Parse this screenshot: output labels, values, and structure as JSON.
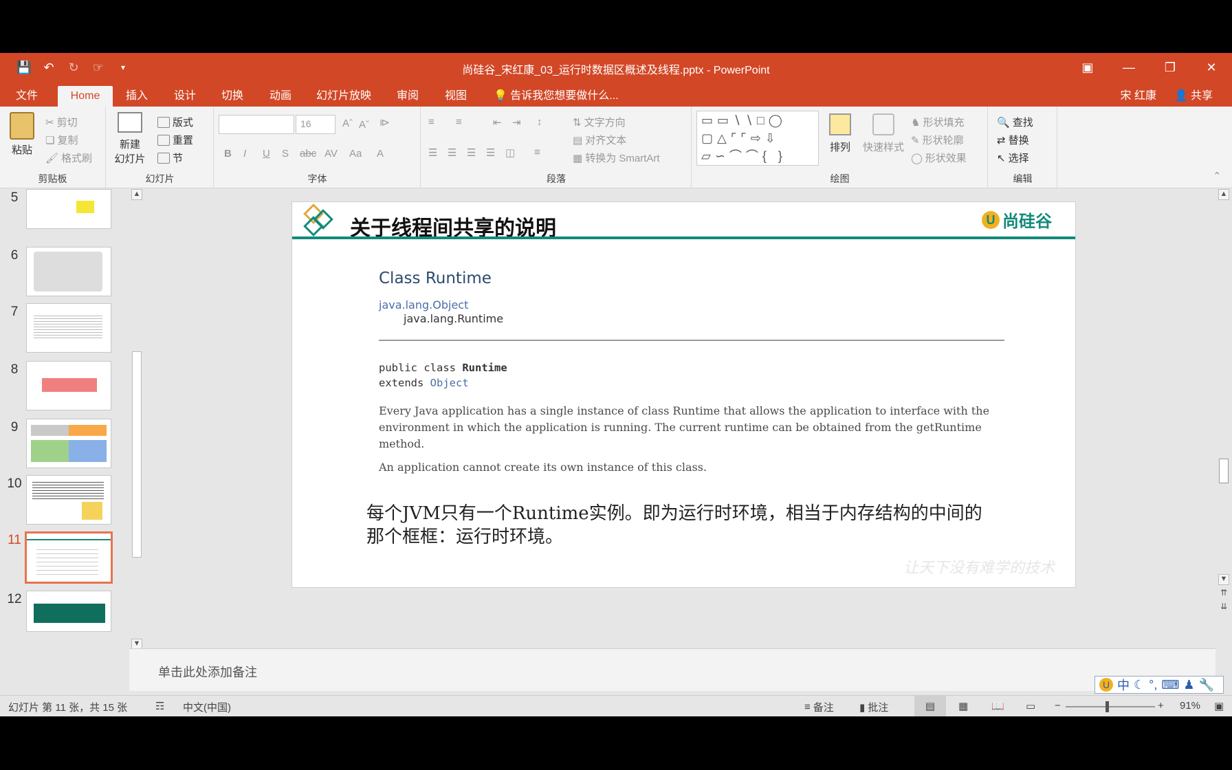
{
  "window": {
    "title": "尚硅谷_宋红康_03_运行时数据区概述及线程.pptx - PowerPoint"
  },
  "tabs": [
    "文件",
    "Home",
    "插入",
    "设计",
    "切换",
    "动画",
    "幻灯片放映",
    "审阅",
    "视图"
  ],
  "tell_me": "告诉我您想要做什么...",
  "user": "宋 红康",
  "share_label": "共享",
  "ribbon": {
    "clipboard": {
      "paste": "粘贴",
      "cut": "剪切",
      "copy": "复制",
      "format_painter": "格式刷",
      "group": "剪贴板"
    },
    "slides": {
      "new_slide_1": "新建",
      "new_slide_2": "幻灯片",
      "layout": "版式",
      "reset": "重置",
      "section": "节",
      "group": "幻灯片"
    },
    "font": {
      "font_size": "16",
      "group": "字体"
    },
    "paragraph": {
      "text_direction": "文字方向",
      "align_text": "对齐文本",
      "convert_smartart": "转换为 SmartArt",
      "group": "段落"
    },
    "drawing": {
      "arrange": "排列",
      "quick_styles": "快速样式",
      "shape_fill": "形状填充",
      "shape_outline": "形状轮廓",
      "shape_effects": "形状效果",
      "group": "绘图"
    },
    "editing": {
      "find": "查找",
      "replace": "替换",
      "select": "选择",
      "group": "编辑"
    }
  },
  "thumbnails": [
    {
      "num": "5"
    },
    {
      "num": "6"
    },
    {
      "num": "7"
    },
    {
      "num": "8"
    },
    {
      "num": "9"
    },
    {
      "num": "10"
    },
    {
      "num": "11"
    },
    {
      "num": "12"
    }
  ],
  "slide": {
    "title": "关于线程间共享的说明",
    "logo_text": "尚硅谷",
    "javadoc": {
      "heading": "Class Runtime",
      "pkg_parent": "java.lang.Object",
      "pkg_class": "java.lang.Runtime",
      "decl_1a": "public class ",
      "decl_1b": "Runtime",
      "decl_2a": "extends ",
      "decl_2b": "Object",
      "desc_1": "Every Java application has a single instance of class Runtime that allows the application to interface with the environment in which the application is running. The current runtime can be obtained from the getRuntime method.",
      "desc_2": "An application cannot create its own instance of this class."
    },
    "chinese_note": "每个JVM只有一个Runtime实例。即为运行时环境，相当于内存结构的中间的那个框框：运行时环境。",
    "watermark": "让天下没有难学的技术"
  },
  "notes_placeholder": "单击此处添加备注",
  "status": {
    "slide_info": "幻灯片 第 11 张，共 15 张",
    "language": "中文(中国)",
    "notes": "备注",
    "comments": "批注",
    "zoom": "91%"
  },
  "ime": {
    "mode": "中"
  },
  "colors": {
    "accent": "#d24726",
    "slide_teal": "#138a7a",
    "selected_thumb": "#e8734f"
  }
}
